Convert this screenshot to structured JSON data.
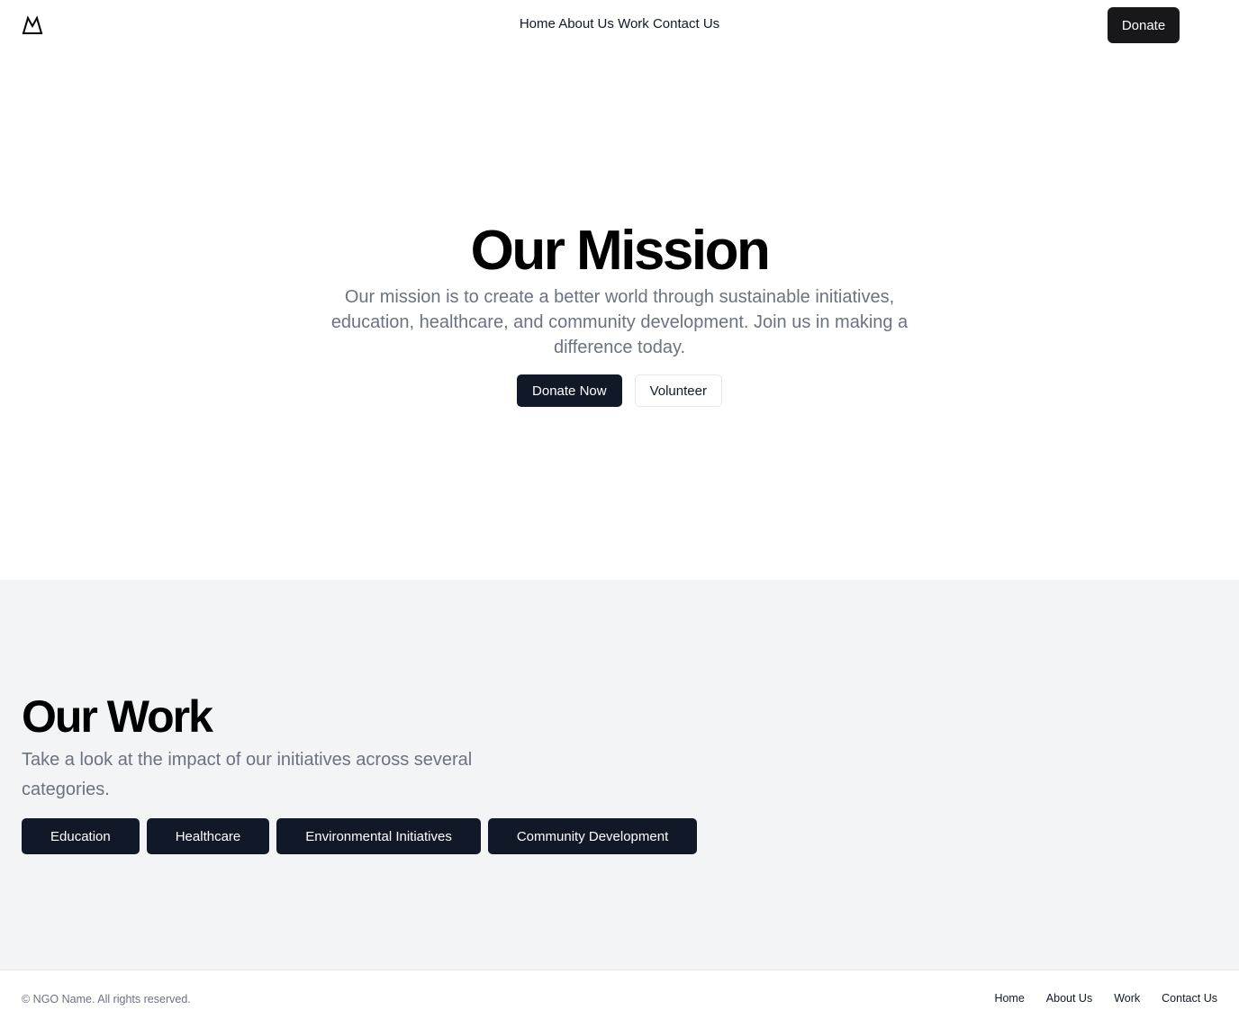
{
  "header": {
    "logo_icon": "mountain-icon",
    "nav": [
      "Home",
      "About Us",
      "Work",
      "Contact Us"
    ],
    "donate_label": "Donate"
  },
  "hero": {
    "title": "Our Mission",
    "text": "Our mission is to create a better world through sustainable initiatives, education, healthcare, and community development. Join us in making a difference today.",
    "primary_label": "Donate Now",
    "secondary_label": "Volunteer"
  },
  "work": {
    "title": "Our Work",
    "text": "Take a look at the impact of our initiatives across several categories.",
    "categories": [
      "Education",
      "Healthcare",
      "Environmental Initiatives",
      "Community Development"
    ]
  },
  "footer": {
    "copyright": "© NGO Name. All rights reserved.",
    "links": [
      "Home",
      "About Us",
      "Work",
      "Contact Us"
    ]
  },
  "colors": {
    "primary_dark": "#111827",
    "muted_text": "#6b7280",
    "section_bg": "#f2f4f6"
  }
}
